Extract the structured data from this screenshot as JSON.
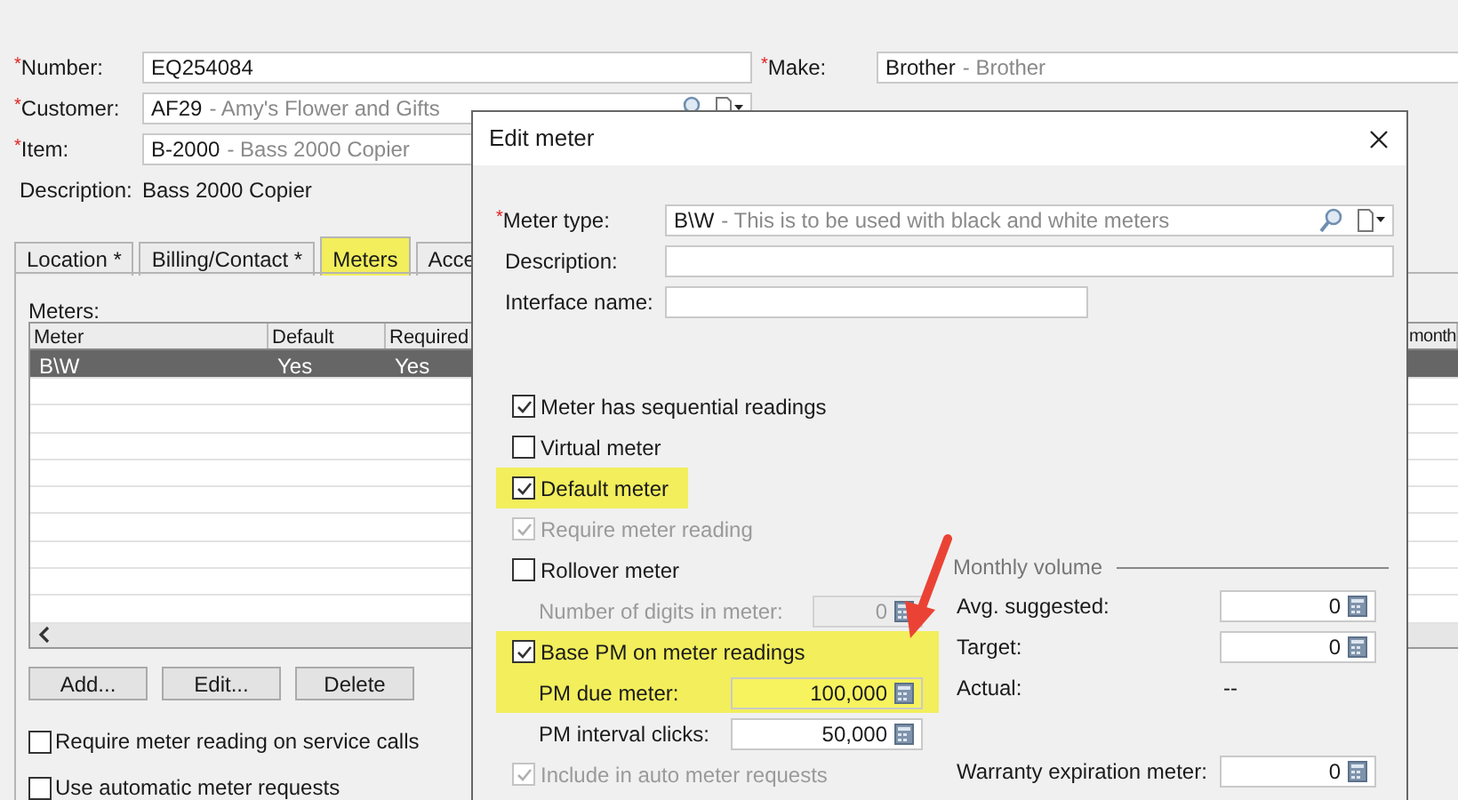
{
  "form": {
    "left_fields": [
      {
        "mark": "*",
        "label": "Number:",
        "value": "EQ254084",
        "kind": "input"
      },
      {
        "mark": "*",
        "label": "Customer:",
        "value": "AF29",
        "detail": "- Amy's Flower and Gifts",
        "kind": "lookup"
      },
      {
        "mark": "*",
        "label": "Item:",
        "value": "B-2000",
        "detail": "- Bass 2000 Copier",
        "kind": "input"
      },
      {
        "label": "Description:",
        "value": "Bass 2000 Copier",
        "kind": "static"
      }
    ],
    "right_fields": [
      {
        "mark": "*",
        "label": "Make:",
        "value": "Brother",
        "detail": "- Brother"
      }
    ]
  },
  "tabs": [
    {
      "label": "Location *",
      "selected": false,
      "highlighted": false
    },
    {
      "label": "Billing/Contact *",
      "selected": false,
      "highlighted": false
    },
    {
      "label": "Meters",
      "selected": true,
      "highlighted": true
    },
    {
      "label": "Acce",
      "selected": false,
      "highlighted": false
    }
  ],
  "meters_panel": {
    "label": "Meters:",
    "table": {
      "columns": [
        "Meter",
        "Default",
        "Required",
        "month"
      ],
      "rows": [
        {
          "cells": [
            "B\\W",
            "Yes",
            "Yes"
          ],
          "selected": true
        }
      ]
    },
    "buttons": [
      "Add...",
      "Edit...",
      "Delete"
    ],
    "options": [
      {
        "label": "Require meter reading on service calls",
        "checked": false
      },
      {
        "label": "Use automatic meter requests",
        "checked": false
      }
    ]
  },
  "dialog": {
    "title": "Edit meter",
    "fields": [
      {
        "mark": "*",
        "label": "Meter type:",
        "value": "B\\W",
        "detail": "- This is to be used with black and white meters",
        "kind": "lookup"
      },
      {
        "label": "Description:",
        "kind": "wide"
      },
      {
        "label": "Interface name:",
        "kind": "short"
      }
    ],
    "options": [
      {
        "kind": "checkbox",
        "label": "Meter has sequential readings",
        "checked": true,
        "disabled": false,
        "highlighted": false
      },
      {
        "kind": "checkbox",
        "label": "Virtual meter",
        "checked": false,
        "disabled": false,
        "highlighted": false
      },
      {
        "kind": "checkbox",
        "label": "Default meter",
        "checked": true,
        "disabled": false,
        "highlighted": true
      },
      {
        "kind": "checkbox",
        "label": "Require meter reading",
        "checked": true,
        "disabled": true,
        "highlighted": false
      },
      {
        "kind": "checkbox",
        "label": "Rollover meter",
        "checked": false,
        "disabled": false,
        "highlighted": false
      },
      {
        "kind": "number",
        "label": "Number of digits in meter:",
        "value": "0",
        "disabled": true,
        "highlighted": false
      },
      {
        "kind": "checkbox",
        "label": "Base PM on meter readings",
        "checked": true,
        "disabled": false,
        "highlighted": true
      },
      {
        "kind": "number",
        "label": "PM due meter:",
        "value": "100,000",
        "disabled": false,
        "highlighted": true
      },
      {
        "kind": "number",
        "label": "PM interval clicks:",
        "value": "50,000",
        "disabled": false,
        "highlighted": false
      },
      {
        "kind": "checkbox",
        "label": "Include in auto meter requests",
        "checked": true,
        "disabled": true,
        "highlighted": false
      }
    ],
    "monthly_volume": {
      "title": "Monthly volume",
      "rows": [
        {
          "kind": "number",
          "label": "Avg. suggested:",
          "value": "0"
        },
        {
          "kind": "number",
          "label": "Target:",
          "value": "0"
        },
        {
          "kind": "text",
          "label": "Actual:",
          "value": "--"
        }
      ]
    },
    "warranty": {
      "label": "Warranty expiration meter:",
      "value": "0"
    }
  }
}
